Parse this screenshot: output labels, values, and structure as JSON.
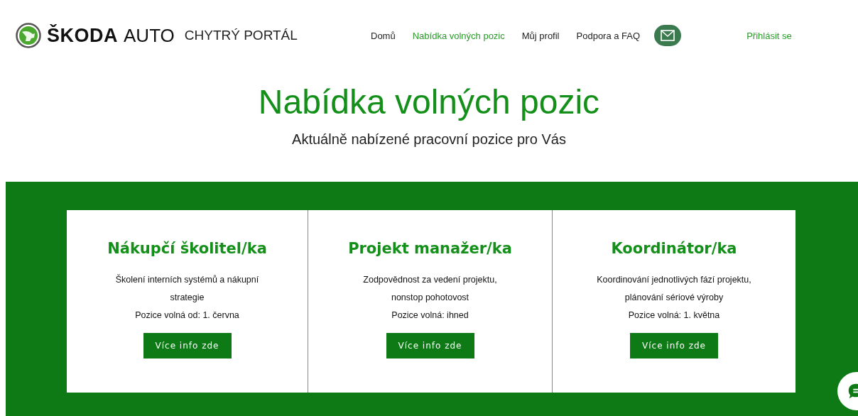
{
  "header": {
    "logo": {
      "brand": "ŠKODA",
      "brand_suffix": "AUTO",
      "portal": "CHYTRÝ PORTÁL"
    },
    "nav": [
      {
        "label": "Domů",
        "selected": false
      },
      {
        "label": "Nabídka volných pozic",
        "selected": true
      },
      {
        "label": "Můj profil",
        "selected": false
      },
      {
        "label": "Podpora a FAQ",
        "selected": false
      }
    ],
    "login": "Přihlásit se"
  },
  "hero": {
    "title": "Nabídka volných pozic",
    "subtitle": "Aktuálně nabízené pracovní pozice pro Vás"
  },
  "positions": [
    {
      "title": "Nákupčí školitel/ka",
      "description": "Školení interních systémů a nákupní strategie",
      "availability": "Pozice volná od: 1. června",
      "button": "Více info zde"
    },
    {
      "title": "Projekt manažer/ka",
      "description": "Zodpovědnost za vedení projektu, nonstop pohotovost",
      "availability": "Pozice volná: ihned",
      "button": "Více info zde"
    },
    {
      "title": "Koordinátor/ka",
      "description": "Koordinování jednotlivých fází projektu, plánování sériové výroby",
      "availability": "Pozice volná: 1. května",
      "button": "Více info zde"
    }
  ]
}
